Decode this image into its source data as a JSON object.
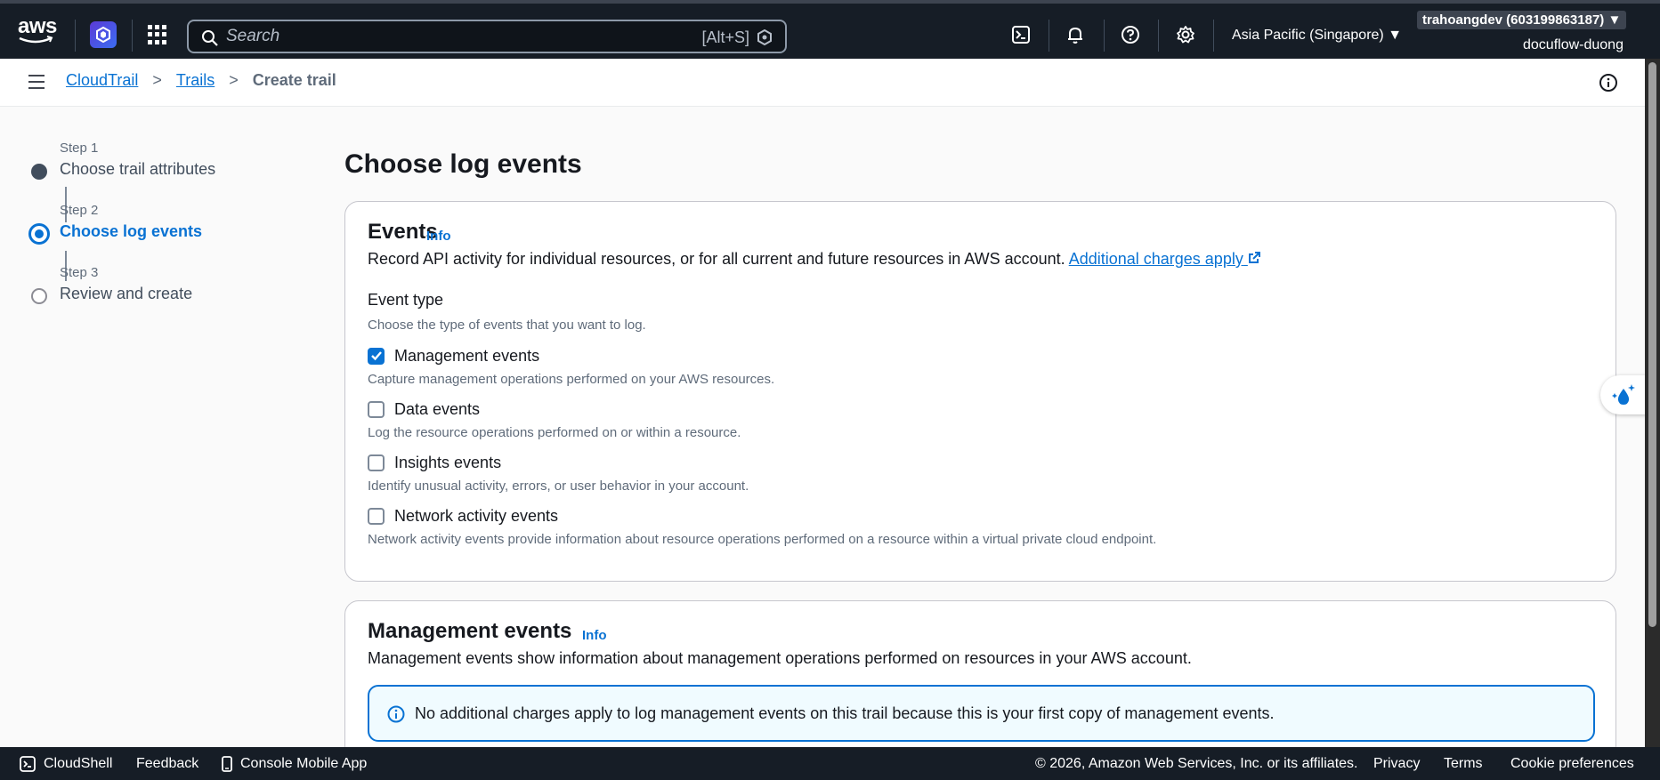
{
  "topnav": {
    "logo_text": "aws",
    "search_placeholder": "Search",
    "search_shortcut": "[Alt+S]",
    "region": "Asia Pacific (Singapore) ▼",
    "account": "trahoangdev (603199863187) ▼",
    "account_sub": "docuflow-duong"
  },
  "breadcrumb": {
    "items": [
      "CloudTrail",
      "Trails"
    ],
    "current": "Create trail",
    "separator": ">"
  },
  "steps": [
    {
      "num": "Step 1",
      "label": "Choose trail attributes",
      "state": "done"
    },
    {
      "num": "Step 2",
      "label": "Choose log events",
      "state": "active"
    },
    {
      "num": "Step 3",
      "label": "Review and create",
      "state": "todo"
    }
  ],
  "main": {
    "title": "Choose log events",
    "events": {
      "heading": "Events",
      "info": "Info",
      "description": "Record API activity for individual resources, or for all current and future resources in AWS account.",
      "charges_link": "Additional charges apply",
      "field_label": "Event type",
      "field_desc": "Choose the type of events that you want to log.",
      "options": [
        {
          "label": "Management events",
          "desc": "Capture management operations performed on your AWS resources.",
          "checked": true
        },
        {
          "label": "Data events",
          "desc": "Log the resource operations performed on or within a resource.",
          "checked": false
        },
        {
          "label": "Insights events",
          "desc": "Identify unusual activity, errors, or user behavior in your account.",
          "checked": false
        },
        {
          "label": "Network activity events",
          "desc": "Network activity events provide information about resource operations performed on a resource within a virtual private cloud endpoint.",
          "checked": false
        }
      ]
    },
    "management": {
      "heading": "Management events",
      "info": "Info",
      "description": "Management events show information about management operations performed on resources in your AWS account.",
      "alert": "No additional charges apply to log management events on this trail because this is your first copy of management events."
    }
  },
  "footer": {
    "cloudshell": "CloudShell",
    "feedback": "Feedback",
    "mobile_app": "Console Mobile App",
    "copyright": "© 2026, Amazon Web Services, Inc. or its affiliates.",
    "privacy": "Privacy",
    "terms": "Terms",
    "cookies": "Cookie preferences"
  },
  "colors": {
    "nav_bg": "#161d26",
    "link": "#0972d3",
    "alert_bg": "#f0fbff"
  }
}
